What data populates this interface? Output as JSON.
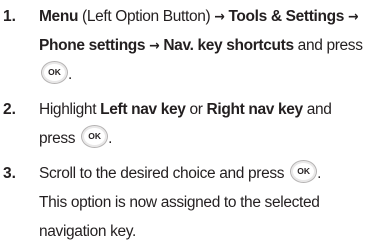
{
  "steps": [
    {
      "number": "1.",
      "lines": [
        [
          {
            "t": "Menu",
            "b": true
          },
          {
            "t": " (Left Option Button) ",
            "b": false
          },
          {
            "t": "→",
            "b": true,
            "arrow": true
          },
          {
            "t": " Tools & Settings ",
            "b": true
          },
          {
            "t": "→",
            "b": true,
            "arrow": true
          }
        ],
        [
          {
            "t": "Phone settings ",
            "b": true
          },
          {
            "t": " →",
            "b": true,
            "arrow": true
          },
          {
            "t": " Nav. key shortcuts",
            "b": true
          },
          {
            "t": " and press",
            "b": false
          }
        ],
        [
          {
            "ok": true
          },
          {
            "t": ".",
            "b": false
          }
        ]
      ]
    },
    {
      "number": "2.",
      "lines": [
        [
          {
            "t": "Highlight ",
            "b": false
          },
          {
            "t": "Left nav key",
            "b": true
          },
          {
            "t": " or ",
            "b": false
          },
          {
            "t": "Right nav key",
            "b": true
          },
          {
            "t": " and",
            "b": false
          }
        ],
        [
          {
            "t": "press ",
            "b": false
          },
          {
            "ok": true
          },
          {
            "t": ".",
            "b": false
          }
        ]
      ]
    },
    {
      "number": "3.",
      "lines": [
        [
          {
            "t": "Scroll to the desired choice and press ",
            "b": false
          },
          {
            "ok": true
          },
          {
            "t": ".",
            "b": false
          }
        ],
        [
          {
            "t": "This option is now assigned to the selected",
            "b": false
          }
        ],
        [
          {
            "t": "navigation key.",
            "b": false
          }
        ]
      ]
    }
  ],
  "ok_button": {
    "label": "OK",
    "icon": "ok-key-icon"
  }
}
